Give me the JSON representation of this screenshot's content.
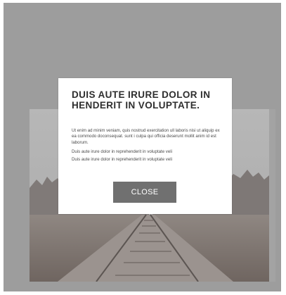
{
  "modal": {
    "title": "DUIS AUTE IRURE DOLOR IN HENDERIT IN VOLUPTATE.",
    "paragraph": "Ut enim ad minim veniam, quis nostrud exercitation ull laboris nisi ut aliquip ex ea commodo doconsequat. sunt i culpa qui officia deserunt mollit anim id est laborum.",
    "line_1": "Duis aute irure dolor in reprehenderit in voluptate veli",
    "line_2": "Duis aute irure dolor in reprehenderit in voluptate veli",
    "close_label": "CLOSE"
  },
  "colors": {
    "overlay": "#9d9d9d",
    "modal_background": "#ffffff",
    "button_background": "#707070",
    "button_text": "#ffffff",
    "title_text": "#2e2e2e"
  }
}
